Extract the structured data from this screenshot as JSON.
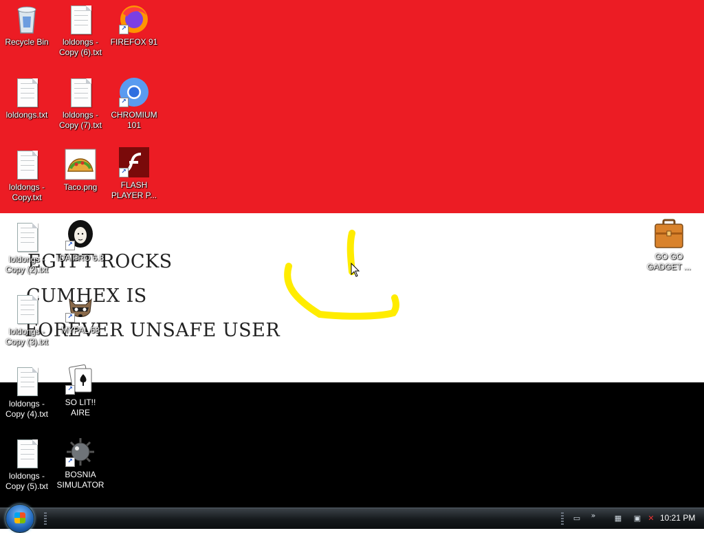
{
  "desktop": {
    "wallpaper_colors": {
      "red": "#ec1c24",
      "white": "#ffffff",
      "black": "#000000",
      "smile": "#ffec00"
    },
    "wallpaper_text": [
      "EGYPT ROCKS",
      "CUMHEX IS",
      "FOREVER UNSAFE USER"
    ],
    "icons": [
      {
        "label": "Recycle Bin",
        "icon": "recycle-bin-icon"
      },
      {
        "label": "loldongs - Copy (6).txt",
        "icon": "text-file-icon"
      },
      {
        "label": "FIREFOX 91",
        "icon": "firefox-icon"
      },
      {
        "label": "loldongs.txt",
        "icon": "text-file-icon"
      },
      {
        "label": "loldongs - Copy (7).txt",
        "icon": "text-file-icon"
      },
      {
        "label": "CHROMIUM 101",
        "icon": "chromium-icon"
      },
      {
        "label": "loldongs - Copy.txt",
        "icon": "text-file-icon"
      },
      {
        "label": "Taco.png",
        "icon": "taco-image-icon"
      },
      {
        "label": "FLASH PLAYER P...",
        "icon": "flash-player-icon"
      },
      {
        "label": "loldongs - Copy (2).txt",
        "icon": "text-file-icon"
      },
      {
        "label": "IDA PRO 6.8",
        "icon": "ida-pro-icon"
      },
      {
        "label": "loldongs - Copy (3).txt",
        "icon": "text-file-icon"
      },
      {
        "label": "MYPAL 68",
        "icon": "raccoon-icon"
      },
      {
        "label": "loldongs - Copy (4).txt",
        "icon": "text-file-icon"
      },
      {
        "label": "SO LIT!! AIRE",
        "icon": "solitaire-icon"
      },
      {
        "label": "loldongs - Copy (5).txt",
        "icon": "text-file-icon"
      },
      {
        "label": "BOSNIA SIMULATOR",
        "icon": "minesweeper-icon"
      },
      {
        "label": "GO GO GADGET ...",
        "icon": "briefcase-icon"
      }
    ]
  },
  "taskbar": {
    "start_button": "start-orb-icon",
    "tray_icons": [
      "display-icon",
      "chevron-icon",
      "network-icon",
      "power-icon",
      "volume-muted-icon"
    ],
    "clock": "10:21 PM"
  }
}
